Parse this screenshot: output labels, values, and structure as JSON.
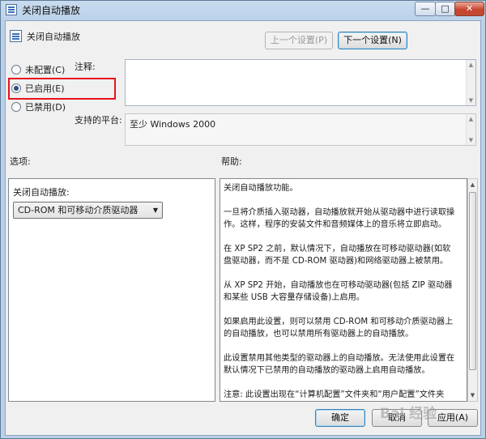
{
  "window": {
    "title": "关闭自动播放",
    "minimize_glyph": "—",
    "maximize_glyph": "□",
    "close_glyph": "✕"
  },
  "header": {
    "setting_title": "关闭自动播放",
    "prev_label": "上一个设置(P)",
    "next_label": "下一个设置(N)"
  },
  "state": {
    "options": [
      {
        "label": "未配置(C)",
        "checked": false
      },
      {
        "label": "已启用(E)",
        "checked": true
      },
      {
        "label": "已禁用(D)",
        "checked": false
      }
    ],
    "highlight_color": "#e8121b"
  },
  "comment": {
    "label": "注释:",
    "value": ""
  },
  "platform": {
    "label": "支持的平台:",
    "value": "至少 Windows 2000"
  },
  "options_section": {
    "label": "选项:",
    "field_label": "关闭自动播放:",
    "selected": "CD-ROM 和可移动介质驱动器"
  },
  "help_section": {
    "label": "帮助:",
    "paragraphs": [
      "关闭自动播放功能。",
      "一旦将介质插入驱动器，自动播放就开始从驱动器中进行读取操作。这样，程序的安装文件和音频媒体上的音乐将立即启动。",
      "在 XP SP2 之前，默认情况下，自动播放在可移动驱动器(如软盘驱动器，而不是 CD-ROM 驱动器)和网络驱动器上被禁用。",
      "从 XP SP2 开始，自动播放也在可移动驱动器(包括 ZIP 驱动器和某些 USB 大容量存储设备)上启用。",
      "如果启用此设置，则可以禁用 CD-ROM 和可移动介质驱动器上的自动播放，也可以禁用所有驱动器上的自动播放。",
      "此设置禁用其他类型的驱动器上的自动播放。无法使用此设置在默认情况下已禁用的自动播放的驱动器上启用自动播放。",
      "注意: 此设置出现在“计算机配置”文件夹和“用户配置”文件夹"
    ]
  },
  "footer": {
    "ok_label": "确定",
    "cancel_label": "取消",
    "apply_label": "应用(A)"
  },
  "watermark": "Bai 经验",
  "icons": {
    "app": "policy-icon",
    "scroll_up": "▲",
    "scroll_down": "▼",
    "dropdown": "▼"
  }
}
